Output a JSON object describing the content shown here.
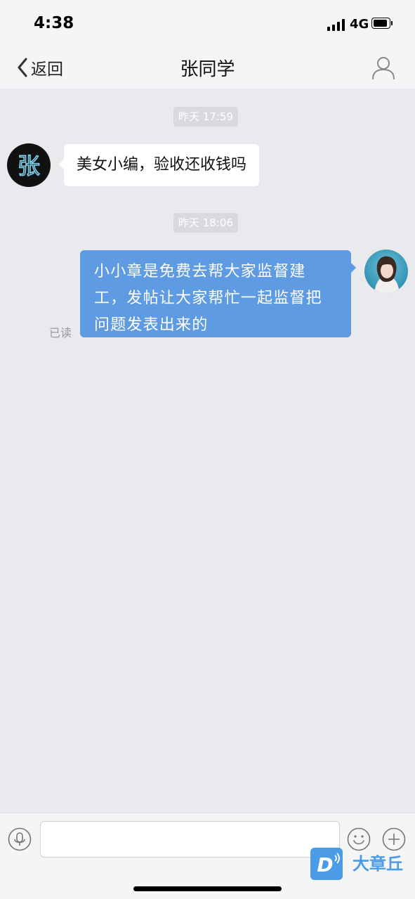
{
  "status_bar": {
    "time": "4:38",
    "network": "4G"
  },
  "nav": {
    "back_label": "返回",
    "title": "张同学"
  },
  "messages": [
    {
      "timestamp": "昨天 17:59",
      "sender": "contact",
      "avatar_text": "张",
      "text": "美女小编，验收还收钱吗"
    },
    {
      "timestamp": "昨天 18:06",
      "sender": "me",
      "lines": [
        "小小章是免费去帮大家监督建",
        "工，发帖让大家帮忙一起监督把",
        "问题发表出来的"
      ],
      "status": "已读"
    }
  ],
  "input": {
    "value": "",
    "placeholder": ""
  },
  "watermark": {
    "text": "大章丘",
    "logo_letter": "D"
  },
  "colors": {
    "outgoing_bubble": "#5e9be2",
    "incoming_bubble": "#ffffff",
    "background": "#e9eaee",
    "watermark": "#4b9be6"
  }
}
